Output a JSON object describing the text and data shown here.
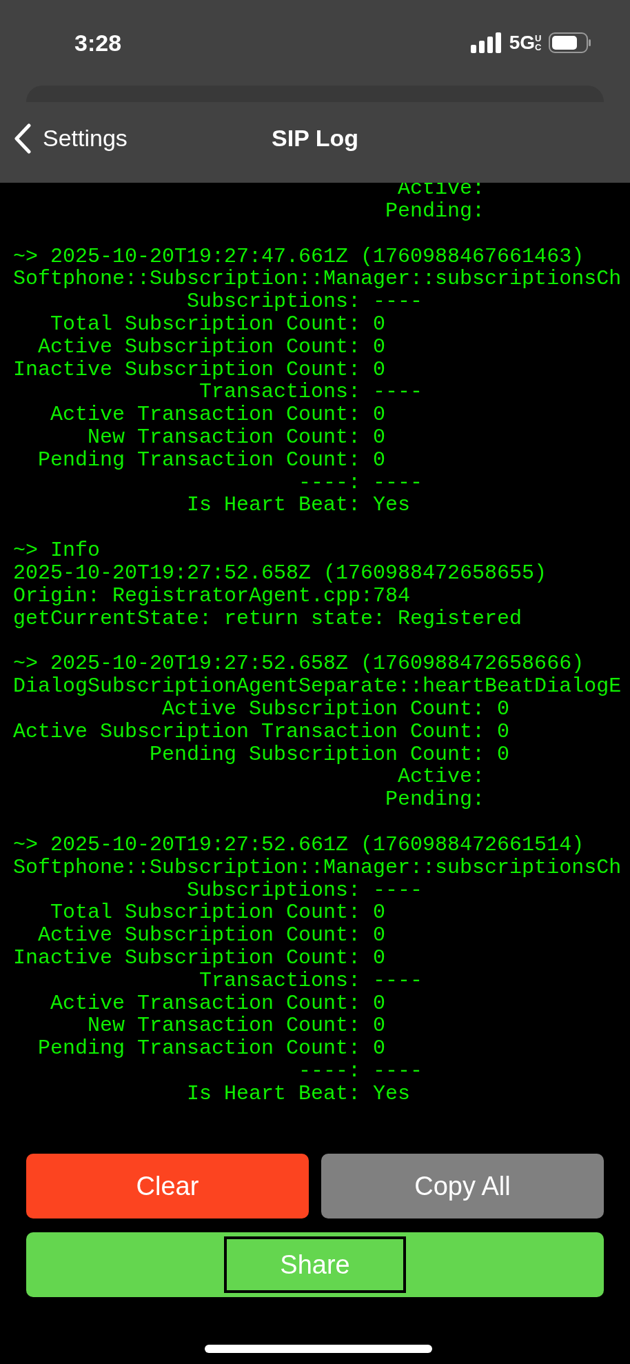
{
  "status_bar": {
    "time": "3:28",
    "network": "5G",
    "network_badge": "UC"
  },
  "nav": {
    "back_label": "Settings",
    "title": "SIP Log"
  },
  "log": [
    {
      "lines": [
        "                               Active:",
        "                              Pending:"
      ]
    },
    {
      "lines": [
        "~> 2025-10-20T19:27:47.661Z (1760988467661463)",
        "Softphone::Subscription::Manager::subscriptionsCh",
        "              Subscriptions: ----",
        "   Total Subscription Count: 0",
        "  Active Subscription Count: 0",
        "Inactive Subscription Count: 0",
        "               Transactions: ----",
        "   Active Transaction Count: 0",
        "      New Transaction Count: 0",
        "  Pending Transaction Count: 0",
        "                       ----: ----",
        "              Is Heart Beat: Yes"
      ]
    },
    {
      "lines": [
        "~> Info",
        "2025-10-20T19:27:52.658Z (1760988472658655)",
        "Origin: RegistratorAgent.cpp:784",
        "getCurrentState: return state: Registered"
      ]
    },
    {
      "lines": [
        "~> 2025-10-20T19:27:52.658Z (1760988472658666)",
        "DialogSubscriptionAgentSeparate::heartBeatDialogE",
        "            Active Subscription Count: 0",
        "Active Subscription Transaction Count: 0",
        "           Pending Subscription Count: 0",
        "                               Active:",
        "                              Pending:"
      ]
    },
    {
      "lines": [
        "~> 2025-10-20T19:27:52.661Z (1760988472661514)",
        "Softphone::Subscription::Manager::subscriptionsCh",
        "              Subscriptions: ----",
        "   Total Subscription Count: 0",
        "  Active Subscription Count: 0",
        "Inactive Subscription Count: 0",
        "               Transactions: ----",
        "   Active Transaction Count: 0",
        "      New Transaction Count: 0",
        "  Pending Transaction Count: 0",
        "                       ----: ----",
        "              Is Heart Beat: Yes"
      ]
    }
  ],
  "buttons": [
    {
      "label": "Clear",
      "kind": "destructive",
      "focused": false
    },
    {
      "label": "Copy All",
      "kind": "neutral",
      "focused": false
    },
    {
      "label": "Share",
      "kind": "confirm",
      "focused": true
    }
  ]
}
